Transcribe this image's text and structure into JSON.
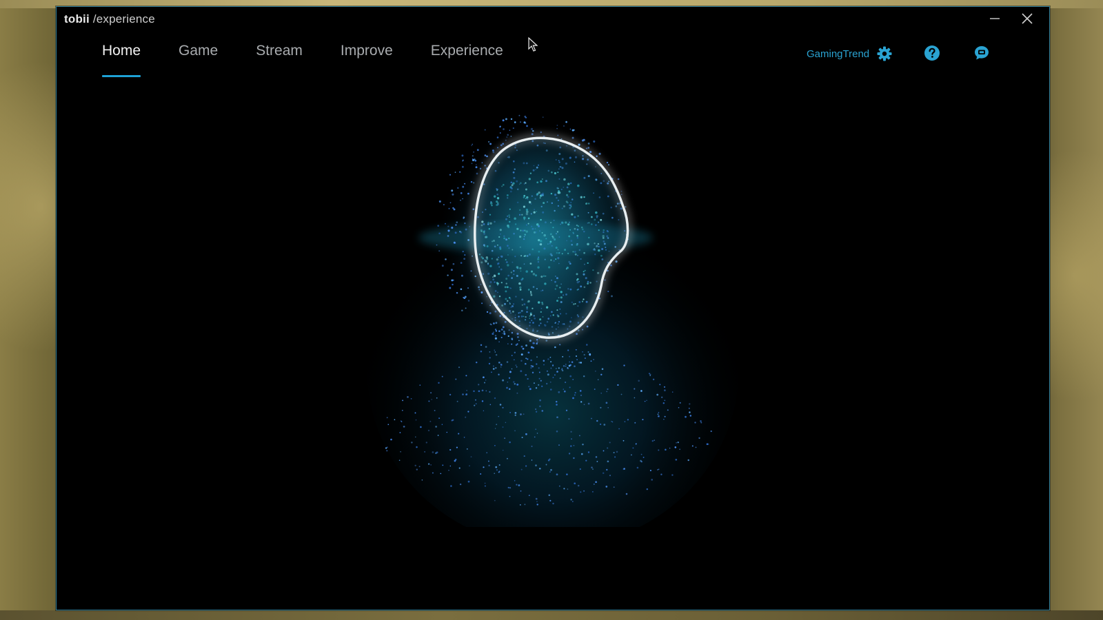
{
  "window": {
    "brand": "tobii",
    "path": " /experience",
    "minimize_icon": "minimize-icon",
    "close_icon": "close-icon"
  },
  "nav": {
    "tabs": [
      {
        "label": "Home",
        "active": true
      },
      {
        "label": "Game",
        "active": false
      },
      {
        "label": "Stream",
        "active": false
      },
      {
        "label": "Improve",
        "active": false
      },
      {
        "label": "Experience",
        "active": false
      }
    ]
  },
  "account": {
    "name": "GamingTrend",
    "settings_icon": "gear-icon"
  },
  "actions": {
    "help_icon": "help-icon",
    "feedback_icon": "chat-bubble-icon"
  },
  "colors": {
    "accent": "#1ea2d6",
    "window_border": "#2f7f9c",
    "background": "#000000"
  }
}
